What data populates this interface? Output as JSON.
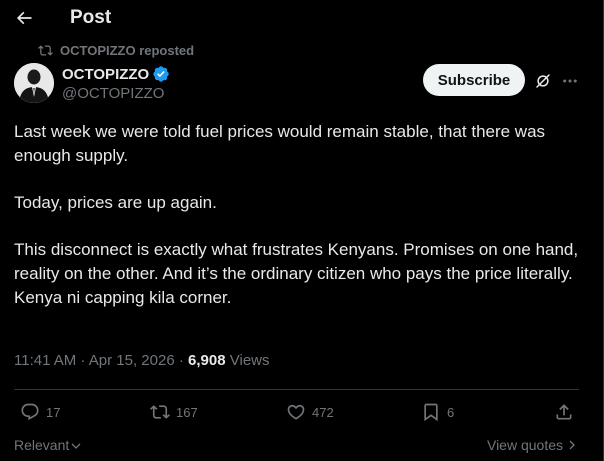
{
  "header": {
    "title": "Post",
    "back_icon": "arrow-left-icon"
  },
  "repost": {
    "text": "OCTOPIZZO reposted",
    "icon": "repost-icon"
  },
  "author": {
    "name": "OCTOPIZZO",
    "handle": "@OCTOPIZZO",
    "verified": true,
    "verified_color": "#1d9bf0"
  },
  "actions_top": {
    "subscribe_label": "Subscribe",
    "grok_icon": "grok-icon",
    "more_icon": "more-horizontal-icon"
  },
  "post": {
    "paragraphs": [
      "Last week we were told fuel prices would remain stable, that there was enough supply.",
      "Today, prices are up again.",
      "This disconnect is exactly what frustrates Kenyans. Promises on one hand, reality on the other. And it’s the ordinary citizen who pays the price literally.",
      "Kenya ni capping kila corner."
    ]
  },
  "meta": {
    "time": "11:41 AM",
    "separator": "·",
    "date": "Apr 15, 2026",
    "views_count": "6,908",
    "views_label": "Views"
  },
  "engagement": {
    "replies": "17",
    "reposts": "167",
    "likes": "472",
    "bookmarks": "6"
  },
  "footer": {
    "sort_label": "Relevant",
    "view_quotes_label": "View quotes"
  },
  "colors": {
    "background": "#000000",
    "text_primary": "#e7e9ea",
    "text_secondary": "#71767b",
    "divider": "#2f3336",
    "button_bg": "#eff3f4"
  }
}
